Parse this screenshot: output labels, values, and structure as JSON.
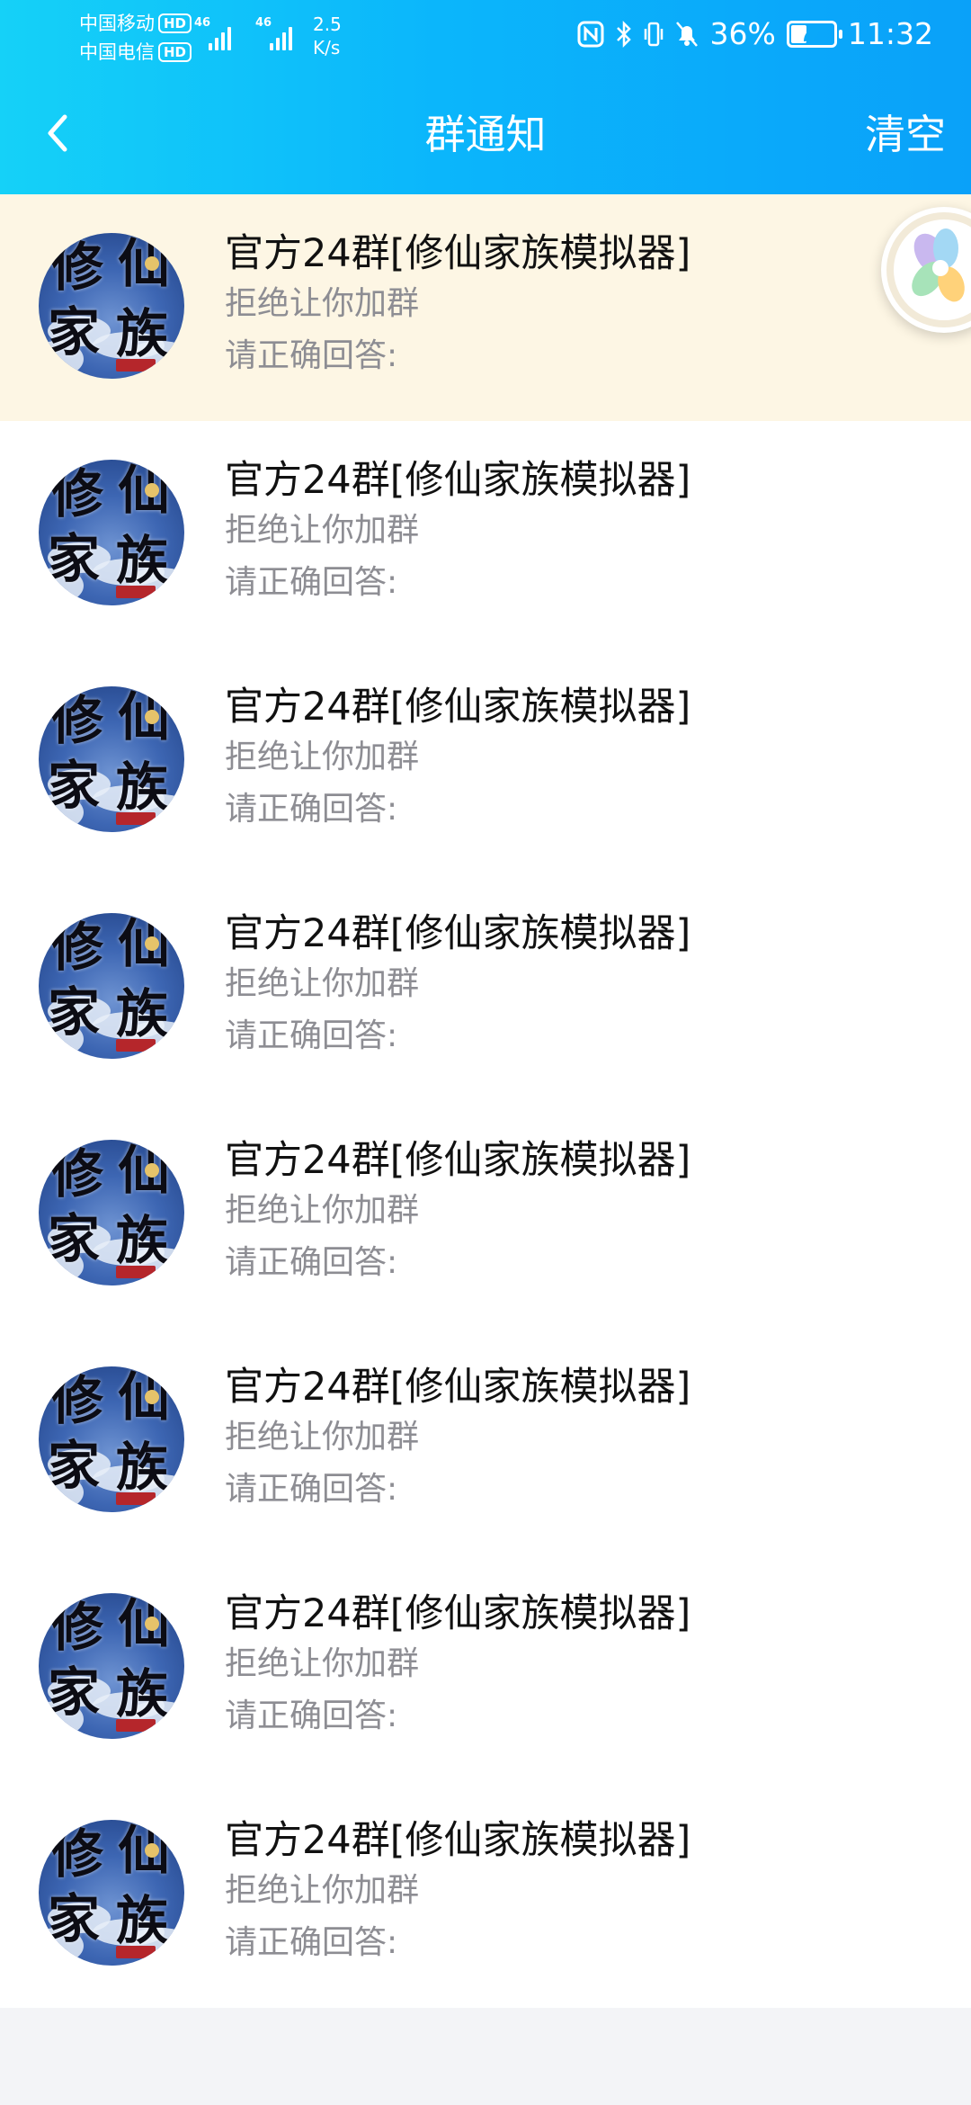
{
  "status_bar": {
    "carrier_1": "中国移动",
    "carrier_2": "中国电信",
    "hd_badge": "HD",
    "network_1": "46",
    "network_2": "46",
    "speed_value": "2.5",
    "speed_unit": "K/s",
    "battery_percent": "36%",
    "battery_level": 0.36,
    "time": "11:32"
  },
  "nav": {
    "back_icon": "chevron-left-icon",
    "title": "群通知",
    "clear_label": "清空"
  },
  "notifications": [
    {
      "title": "官方24群[修仙家族模拟器]",
      "status": "拒绝让你加群",
      "answer": "请正确回答:",
      "highlighted": true
    },
    {
      "title": "官方24群[修仙家族模拟器]",
      "status": "拒绝让你加群",
      "answer": "请正确回答:"
    },
    {
      "title": "官方24群[修仙家族模拟器]",
      "status": "拒绝让你加群",
      "answer": "请正确回答:"
    },
    {
      "title": "官方24群[修仙家族模拟器]",
      "status": "拒绝让你加群",
      "answer": "请正确回答:"
    },
    {
      "title": "官方24群[修仙家族模拟器]",
      "status": "拒绝让你加群",
      "answer": "请正确回答:"
    },
    {
      "title": "官方24群[修仙家族模拟器]",
      "status": "拒绝让你加群",
      "answer": "请正确回答:"
    },
    {
      "title": "官方24群[修仙家族模拟器]",
      "status": "拒绝让你加群",
      "answer": "请正确回答:"
    },
    {
      "title": "官方24群[修仙家族模拟器]",
      "status": "拒绝让你加群",
      "answer": "请正确回答:"
    }
  ],
  "avatar": {
    "glyphs": [
      "修",
      "仙",
      "家",
      "族"
    ]
  },
  "colors": {
    "header_start": "#15d1f8",
    "header_end": "#0aa1f9",
    "highlight_row": "#fdf6e4",
    "secondary_text": "#8d8d93"
  }
}
